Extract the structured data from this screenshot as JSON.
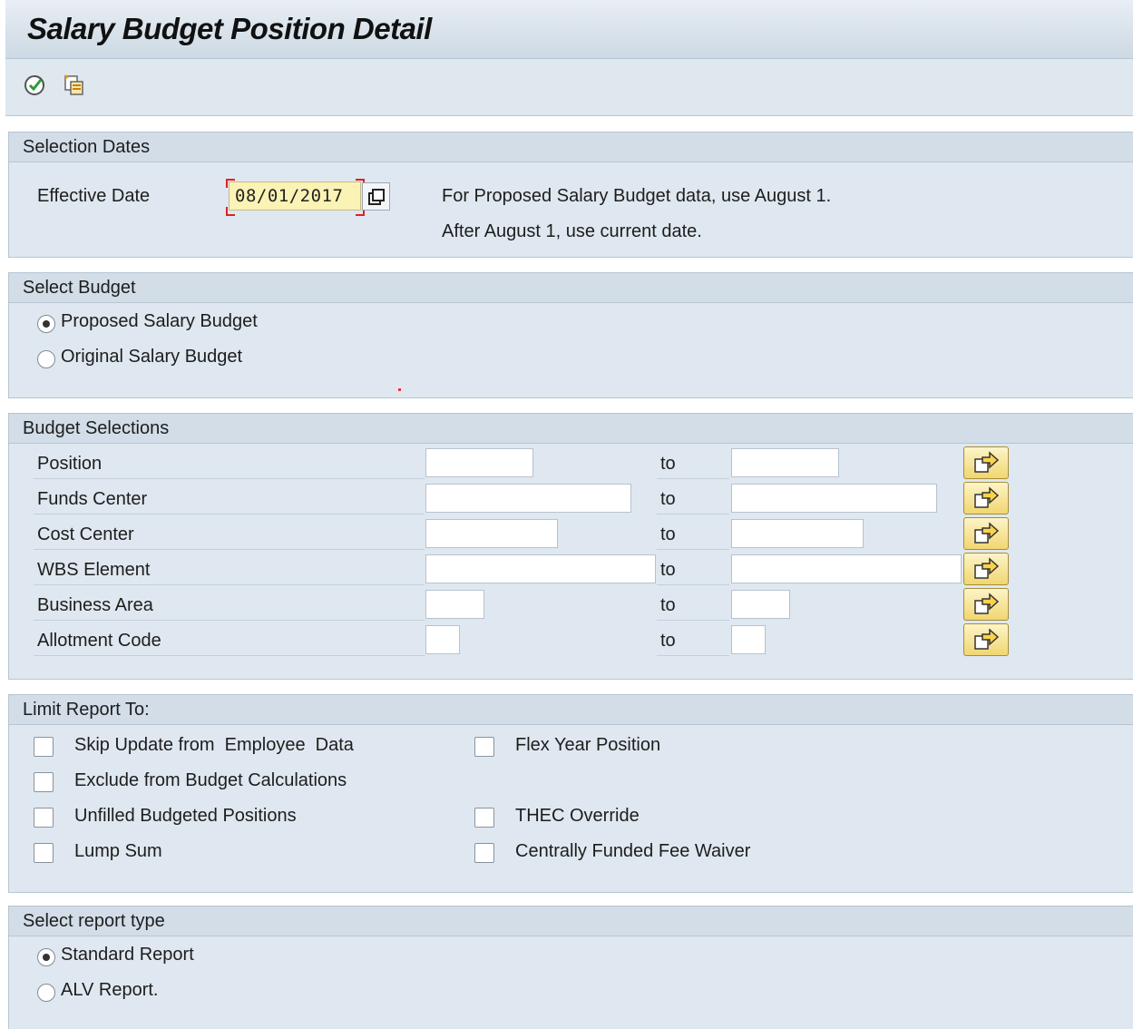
{
  "header": {
    "title": "Salary Budget Position Detail"
  },
  "toolbar": {
    "icons": [
      "execute-icon",
      "get-variant-icon"
    ]
  },
  "selection_dates": {
    "title": "Selection Dates",
    "effective_date_label": "Effective Date",
    "effective_date_value": "08/01/2017",
    "note_line1": "For Proposed Salary Budget data, use August 1.",
    "note_line2": "After August 1, use current date."
  },
  "select_budget": {
    "title": "Select Budget",
    "options": [
      {
        "label": "Proposed Salary Budget",
        "selected": true
      },
      {
        "label": "Original Salary Budget",
        "selected": false
      }
    ]
  },
  "budget_selections": {
    "title": "Budget Selections",
    "to_label": "to",
    "rows": [
      {
        "label": "Position",
        "from": "",
        "to": ""
      },
      {
        "label": "Funds Center",
        "from": "",
        "to": ""
      },
      {
        "label": "Cost Center",
        "from": "",
        "to": ""
      },
      {
        "label": "WBS Element",
        "from": "",
        "to": ""
      },
      {
        "label": "Business Area",
        "from": "",
        "to": ""
      },
      {
        "label": "Allotment Code",
        "from": "",
        "to": ""
      }
    ]
  },
  "limit_report": {
    "title": "Limit Report To:",
    "left": [
      {
        "label": "Skip Update from  Employee  Data",
        "checked": false
      },
      {
        "label": "Exclude from Budget Calculations",
        "checked": false
      },
      {
        "label": "Unfilled Budgeted Positions",
        "checked": false
      },
      {
        "label": "Lump Sum",
        "checked": false
      }
    ],
    "right": [
      {
        "label": "Flex Year Position",
        "checked": false
      },
      {
        "label": "THEC Override",
        "checked": false
      },
      {
        "label": "Centrally Funded Fee Waiver",
        "checked": false
      }
    ]
  },
  "report_type": {
    "title": "Select report type",
    "options": [
      {
        "label": "Standard Report",
        "selected": true
      },
      {
        "label": "ALV Report.",
        "selected": false
      }
    ]
  },
  "colors": {
    "date_field_bg": "#fbf2b5",
    "group_bg": "#dfe8f0",
    "multi_select_btn": "#f1d670"
  }
}
